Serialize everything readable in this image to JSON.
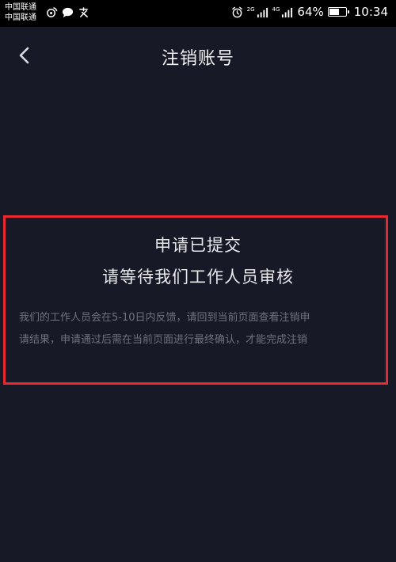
{
  "status_bar": {
    "carrier_1": "中国联通",
    "carrier_2": "中国联通",
    "left_icons": [
      "weibo-icon",
      "message-icon",
      "app-icon"
    ],
    "right_icons": [
      "alarm-icon",
      "signal-icon",
      "signal-icon"
    ],
    "net_tag_1": "2G",
    "net_tag_2": "4G",
    "battery_percent_text": "64%",
    "battery_level": 0.64,
    "time": "10:34"
  },
  "nav": {
    "back_icon": "chevron-left-icon",
    "title": "注销账号"
  },
  "main": {
    "headline": "申请已提交",
    "subheadline": "请等待我们工作人员审核",
    "description_line_1": "我们的工作人员会在5-10日内反馈，请回到当前页面查看注销申",
    "description_line_2": "请结果，申请通过后需在当前页面进行最终确认，才能完成注销"
  },
  "colors": {
    "background": "#171a26",
    "highlight_border": "#e8292f",
    "description_text": "#6f7180"
  }
}
